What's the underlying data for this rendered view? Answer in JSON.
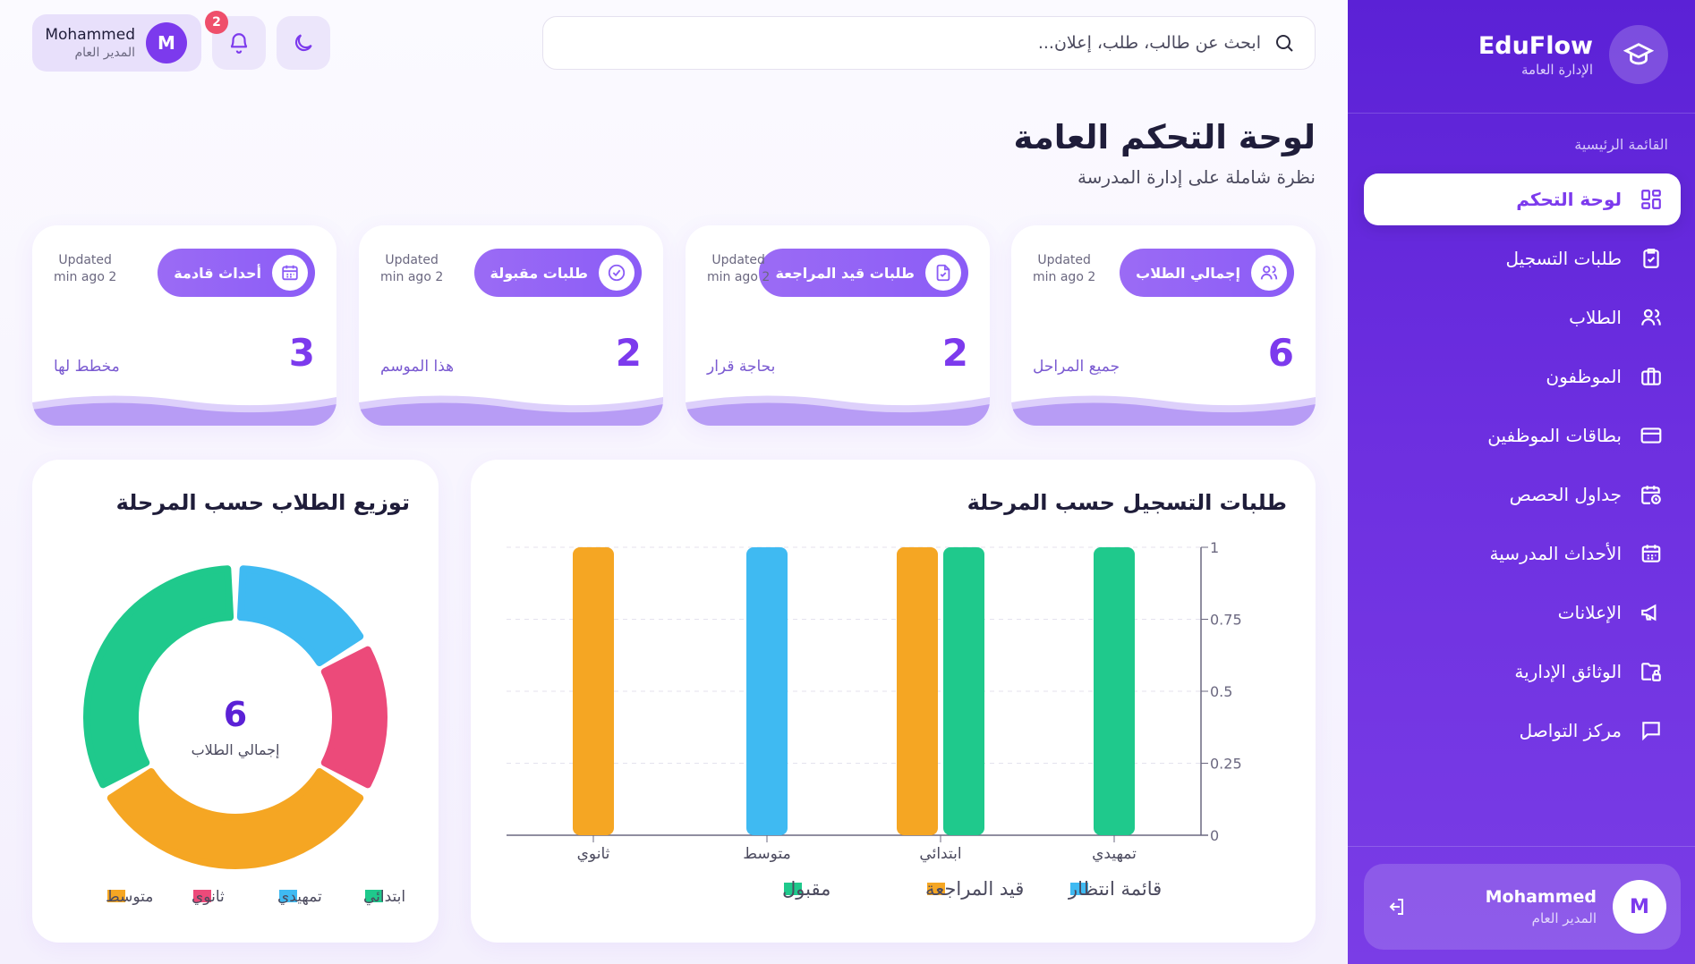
{
  "topbar": {
    "search_placeholder": "ابحث عن طالب، طلب، إعلان...",
    "notifications_count": "2",
    "user_name": "Mohammed",
    "user_role": "المدير العام",
    "user_initial": "M"
  },
  "page": {
    "title": "لوحة التحكم العامة",
    "subtitle": "نظرة شاملة على إدارة المدرسة"
  },
  "stats": [
    {
      "label": "إجمالي الطلاب",
      "value": "6",
      "sub": "جميع المراحل",
      "updated_1": "Updated",
      "updated_2": "min ago 2",
      "icon": "users-icon"
    },
    {
      "label": "طلبات قيد المراجعة",
      "value": "2",
      "sub": "بحاجة قرار",
      "updated_1": "Updated",
      "updated_2": "min ago 2",
      "icon": "file-check-icon"
    },
    {
      "label": "طلبات مقبولة",
      "value": "2",
      "sub": "هذا الموسم",
      "updated_1": "Updated",
      "updated_2": "min ago 2",
      "icon": "check-circle-icon"
    },
    {
      "label": "أحداث قادمة",
      "value": "3",
      "sub": "مخطط لها",
      "updated_1": "Updated",
      "updated_2": "min ago 2",
      "icon": "calendar-icon"
    }
  ],
  "colors": {
    "accent": "#7c3aed",
    "green": "#1fc98c",
    "blue": "#3fbaf2",
    "orange": "#f5a623",
    "pink": "#ec4a7a"
  },
  "bar_panel": {
    "title": "طلبات التسجيل حسب المرحلة"
  },
  "donut_panel": {
    "title": "توزيع الطلاب حسب المرحلة",
    "center_value": "6",
    "center_label": "إجمالي الطلاب"
  },
  "chart_data": [
    {
      "type": "bar",
      "title": "طلبات التسجيل حسب المرحلة",
      "categories": [
        "تمهيدي",
        "ابتدائي",
        "متوسط",
        "ثانوي"
      ],
      "ylim": [
        0,
        1
      ],
      "yticks": [
        "0",
        "0.25",
        "0.5",
        "0.75",
        "1"
      ],
      "grid": true,
      "legend_position": "bottom",
      "series": [
        {
          "name": "قائمة انتظار",
          "color": "#3fbaf2",
          "values": [
            0,
            0,
            1,
            0
          ]
        },
        {
          "name": "قيد المراجعة",
          "color": "#f5a623",
          "values": [
            0,
            1,
            0,
            1
          ]
        },
        {
          "name": "مقبول",
          "color": "#1fc98c",
          "values": [
            1,
            1,
            0,
            0
          ]
        }
      ]
    },
    {
      "type": "pie",
      "title": "توزيع الطلاب حسب المرحلة",
      "categories": [
        "ابتدائي",
        "تمهيدي",
        "ثانوي",
        "متوسط"
      ],
      "values": [
        2,
        1,
        1,
        2
      ],
      "colors": [
        "#1fc98c",
        "#3fbaf2",
        "#ec4a7a",
        "#f5a623"
      ],
      "legend_position": "bottom"
    }
  ],
  "sidebar": {
    "brand": "EduFlow",
    "brand_sub": "الإدارة العامة",
    "section_label": "القائمة الرئيسية",
    "items": [
      {
        "label": "لوحة التحكم",
        "icon": "dashboard-icon",
        "active": true
      },
      {
        "label": "طلبات التسجيل",
        "icon": "clipboard-check-icon"
      },
      {
        "label": "الطلاب",
        "icon": "users-icon"
      },
      {
        "label": "الموظفون",
        "icon": "briefcase-icon"
      },
      {
        "label": "بطاقات الموظفين",
        "icon": "credit-card-icon"
      },
      {
        "label": "جداول الحصص",
        "icon": "calendar-clock-icon"
      },
      {
        "label": "الأحداث المدرسية",
        "icon": "calendar-icon"
      },
      {
        "label": "الإعلانات",
        "icon": "megaphone-icon"
      },
      {
        "label": "الوثائق الإدارية",
        "icon": "folder-lock-icon"
      },
      {
        "label": "مركز التواصل",
        "icon": "message-icon"
      }
    ],
    "user_name": "Mohammed",
    "user_role": "المدير العام",
    "user_initial": "M"
  }
}
